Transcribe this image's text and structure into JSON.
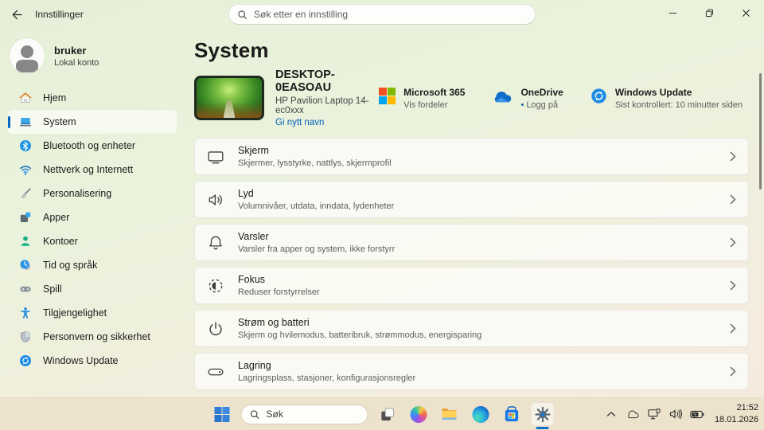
{
  "window": {
    "title": "Innstillinger",
    "search_placeholder": "Søk etter en innstilling"
  },
  "sidebar": {
    "user": {
      "name": "bruker",
      "subtitle": "Lokal konto"
    },
    "items": [
      {
        "label": "Hjem",
        "icon": "home-icon",
        "selected": false
      },
      {
        "label": "System",
        "icon": "system-icon",
        "selected": true
      },
      {
        "label": "Bluetooth og enheter",
        "icon": "bluetooth-icon",
        "selected": false
      },
      {
        "label": "Nettverk og Internett",
        "icon": "network-icon",
        "selected": false
      },
      {
        "label": "Personalisering",
        "icon": "personalization-icon",
        "selected": false
      },
      {
        "label": "Apper",
        "icon": "apps-icon",
        "selected": false
      },
      {
        "label": "Kontoer",
        "icon": "accounts-icon",
        "selected": false
      },
      {
        "label": "Tid og språk",
        "icon": "time-language-icon",
        "selected": false
      },
      {
        "label": "Spill",
        "icon": "gaming-icon",
        "selected": false
      },
      {
        "label": "Tilgjengelighet",
        "icon": "accessibility-icon",
        "selected": false
      },
      {
        "label": "Personvern og sikkerhet",
        "icon": "privacy-icon",
        "selected": false
      },
      {
        "label": "Windows Update",
        "icon": "windows-update-icon",
        "selected": false
      }
    ]
  },
  "main": {
    "title": "System",
    "device": {
      "name": "DESKTOP-0EASOAU",
      "model": "HP Pavilion Laptop 14-ec0xxx",
      "rename_link": "Gi nytt navn"
    },
    "status": [
      {
        "title": "Microsoft 365",
        "subtitle": "Vis fordeler",
        "icon": "microsoft-365-logo"
      },
      {
        "title": "OneDrive",
        "subtitle": "Logg på",
        "bullet": "•",
        "icon": "onedrive-icon"
      },
      {
        "title": "Windows Update",
        "subtitle": "Sist kontrollert: 10 minutter siden",
        "icon": "windows-update-icon"
      }
    ],
    "cards": [
      {
        "title": "Skjerm",
        "subtitle": "Skjermer, lysstyrke, nattlys, skjermprofil",
        "icon": "display-icon"
      },
      {
        "title": "Lyd",
        "subtitle": "Volumnivåer, utdata, inndata, lydenheter",
        "icon": "sound-icon"
      },
      {
        "title": "Varsler",
        "subtitle": "Varsler fra apper og system, ikke forstyrr",
        "icon": "notifications-icon"
      },
      {
        "title": "Fokus",
        "subtitle": "Reduser forstyrrelser",
        "icon": "focus-icon"
      },
      {
        "title": "Strøm og batteri",
        "subtitle": "Skjerm og hvilemodus, batteribruk, strømmodus, energisparing",
        "icon": "power-icon"
      },
      {
        "title": "Lagring",
        "subtitle": "Lagringsplass, stasjoner, konfigurasjonsregler",
        "icon": "storage-icon"
      }
    ]
  },
  "taskbar": {
    "search_placeholder": "Søk",
    "apps": [
      "start",
      "search",
      "task-view",
      "copilot",
      "file-explorer",
      "edge",
      "microsoft-store",
      "settings"
    ],
    "active_app": "settings",
    "clock": {
      "time": "21:52",
      "date": "18.01.2026"
    }
  },
  "colors": {
    "accent_blue": "#0067c0",
    "link_blue": "#0061b8",
    "taskbar_bg": "#ede2cc",
    "ms_logo": {
      "red": "#f25022",
      "green": "#7fba00",
      "blue": "#00a4ef",
      "yellow": "#ffb900"
    },
    "onedrive_blue": "#0f6cc9"
  }
}
